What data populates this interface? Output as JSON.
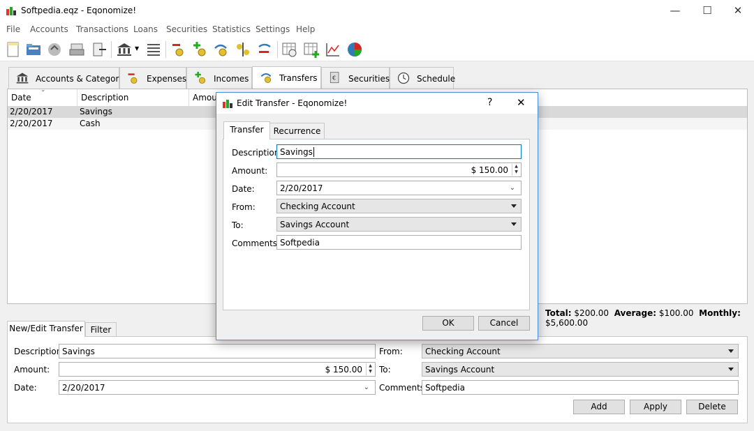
{
  "window": {
    "title": "Softpedia.eqz - Eqonomize!",
    "min_icon": "minimize-icon",
    "max_icon": "maximize-icon",
    "close_icon": "close-icon"
  },
  "menu": [
    "File",
    "Accounts",
    "Transactions",
    "Loans",
    "Securities",
    "Statistics",
    "Settings",
    "Help"
  ],
  "tabs": [
    {
      "label": "Accounts & Categories",
      "icon": "bank-icon"
    },
    {
      "label": "Expenses",
      "icon": "expenses-icon"
    },
    {
      "label": "Incomes",
      "icon": "incomes-icon"
    },
    {
      "label": "Transfers",
      "icon": "transfers-icon"
    },
    {
      "label": "Securities",
      "icon": "securities-icon"
    },
    {
      "label": "Schedule",
      "icon": "schedule-icon"
    }
  ],
  "list": {
    "headers": [
      "Date",
      "Description",
      "Amou"
    ],
    "rows": [
      {
        "date": "2/20/2017",
        "description": "Savings"
      },
      {
        "date": "2/20/2017",
        "description": "Cash"
      }
    ]
  },
  "totals": {
    "total_label": "Total:",
    "total": "$200.00",
    "average_label": "Average:",
    "average": "$100.00",
    "monthly_label": "Monthly:",
    "monthly": "$5,600.00"
  },
  "bottom": {
    "tabs": [
      "New/Edit Transfer",
      "Filter"
    ],
    "description_label": "Description:",
    "description": "Savings",
    "amount_label": "Amount:",
    "amount": "$ 150.00",
    "date_label": "Date:",
    "date": "2/20/2017",
    "from_label": "From:",
    "from": "Checking Account",
    "to_label": "To:",
    "to": "Savings Account",
    "comments_label": "Comments:",
    "comments": "Softpedia",
    "add": "Add",
    "apply": "Apply",
    "delete": "Delete"
  },
  "dialog": {
    "title": "Edit Transfer - Eqonomize!",
    "help": "?",
    "tabs": [
      "Transfer",
      "Recurrence"
    ],
    "description_label": "Description:",
    "description": "Savings",
    "amount_label": "Amount:",
    "amount": "$ 150.00",
    "date_label": "Date:",
    "date": "2/20/2017",
    "from_label": "From:",
    "from": "Checking Account",
    "to_label": "To:",
    "to": "Savings Account",
    "comments_label": "Comments:",
    "comments": "Softpedia",
    "ok": "OK",
    "cancel": "Cancel"
  },
  "colors": {
    "accent": "#0078d7",
    "selected_row": "#d9d9d9",
    "dialog_border": "#4a90d9"
  }
}
